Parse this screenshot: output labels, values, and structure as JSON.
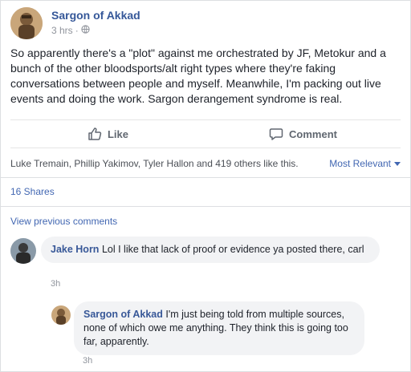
{
  "post": {
    "author": "Sargon of Akkad",
    "time": "3 hrs",
    "privacy_icon": "globe-icon",
    "text": "So apparently there's a \"plot\" against me orchestrated by JF, Metokur and a bunch of the other bloodsports/alt right types where they're faking conversations between people and myself. Meanwhile, I'm packing out live events and doing the work. Sargon derangement syndrome is real.",
    "like_label": "Like",
    "comment_label": "Comment",
    "likes_text": "Luke Tremain, Phillip Yakimov, Tyler Hallon and 419 others like this.",
    "sort_label": "Most Relevant",
    "shares": "16 Shares",
    "view_previous": "View previous comments"
  },
  "comments": [
    {
      "author": "Jake Horn",
      "text": "Lol I like that lack of proof or evidence ya posted there, carl",
      "time": "3h"
    },
    {
      "author": "Sargon of Akkad",
      "text": "I'm just being told from multiple sources, none of which owe me anything. They think this is going too far, apparently.",
      "time": "3h"
    }
  ],
  "colors": {
    "link": "#365899",
    "accent": "#4267b2",
    "meta": "#90949c",
    "bubble": "#f2f3f5"
  }
}
